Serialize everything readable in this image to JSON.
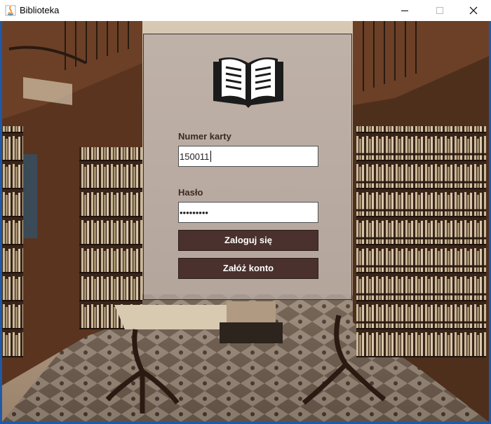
{
  "window": {
    "title": "Biblioteka",
    "icon": "java-icon",
    "controls": [
      "minimize-icon",
      "maximize-icon",
      "close-icon"
    ]
  },
  "background": {
    "subject": "library-hall-image"
  },
  "login": {
    "logo_icon": "open-book-icon",
    "card_label": "Numer karty",
    "card_value": "150011",
    "password_label": "Hasło",
    "password_value": "123456789",
    "login_button": "Zaloguj się",
    "register_button": "Załóż konto"
  },
  "colors": {
    "panel": "#b6aaa4",
    "button": "#4a312d",
    "label_text": "#3b2a24"
  }
}
